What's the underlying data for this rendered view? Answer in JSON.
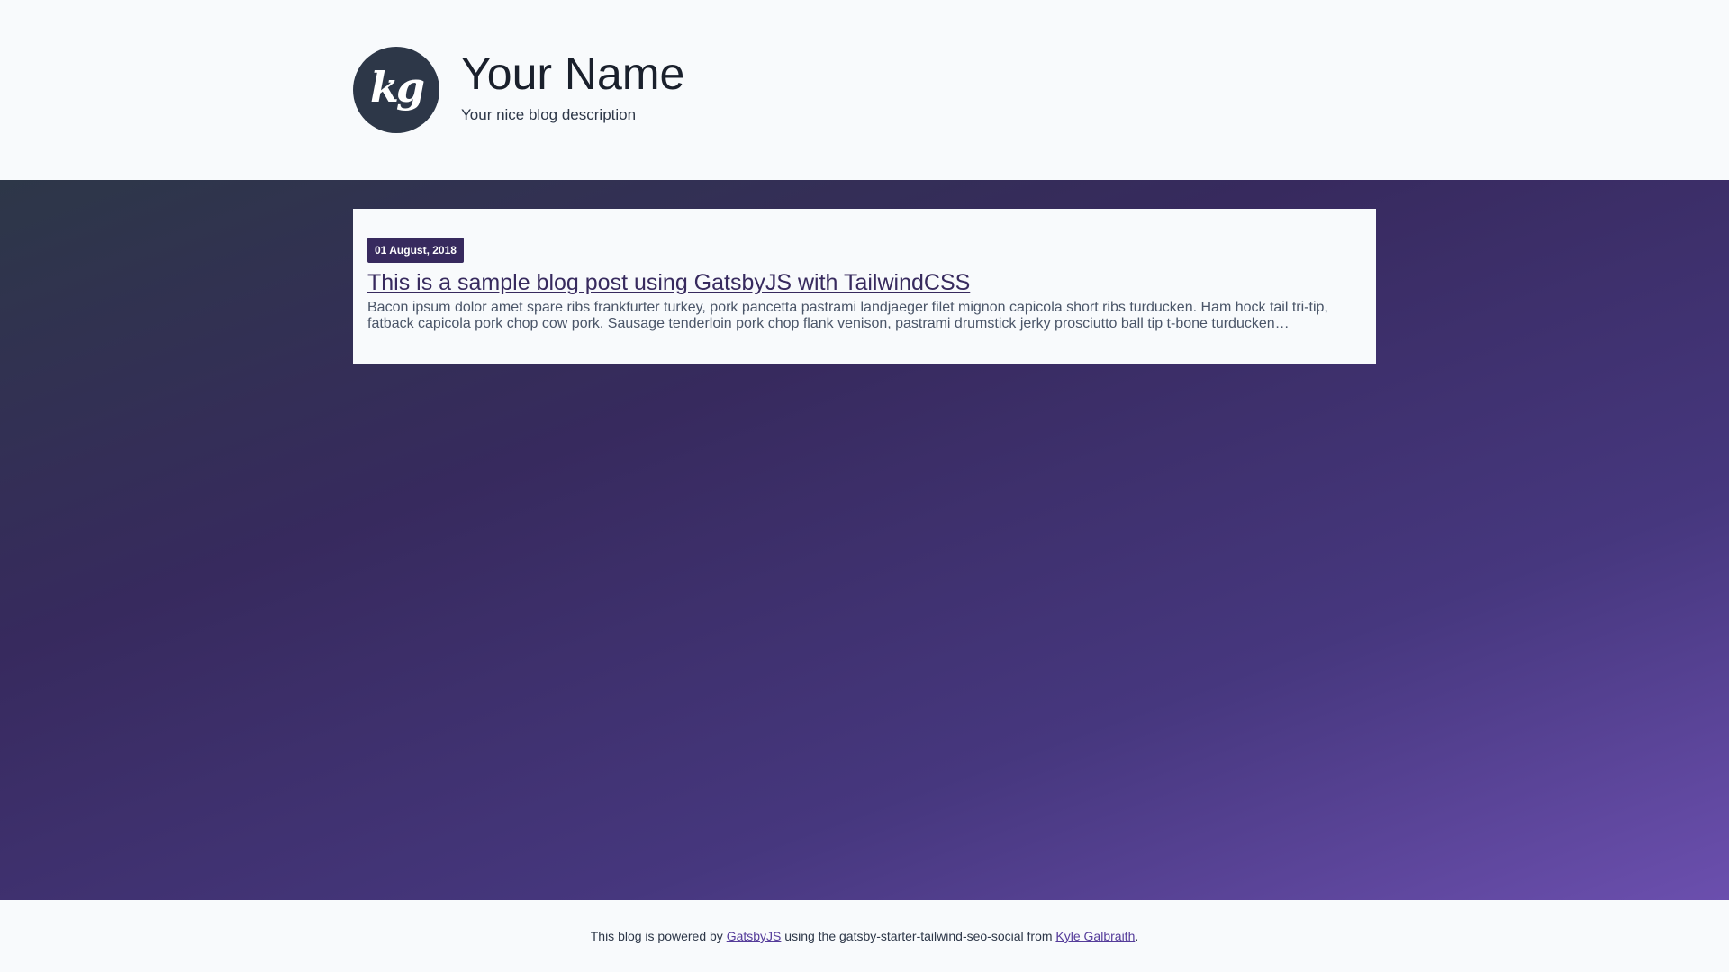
{
  "header": {
    "logo_text": "kg",
    "site_title": "Your Name",
    "site_description": "Your nice blog description"
  },
  "posts": [
    {
      "date": "01 August, 2018",
      "title": "This is a sample blog post using GatsbyJS with TailwindCSS",
      "excerpt": "Bacon ipsum dolor amet spare ribs frankfurter turkey, pork pancetta pastrami landjaeger filet mignon capicola short ribs turducken. Ham hock tail tri-tip, fatback capicola pork chop cow pork. Sausage tenderloin pork chop flank venison, pastrami drumstick jerky prosciutto ball tip t-bone turducken…"
    }
  ],
  "footer": {
    "text_before": "This blog is powered by ",
    "link1_label": "GatsbyJS",
    "text_middle": " using the gatsby-starter-tailwind-seo-social from ",
    "link2_label": "Kyle Galbraith",
    "text_after": "."
  },
  "colors": {
    "accent": "#372a5e",
    "link": "#553c9a",
    "logo_bg": "#2d3748",
    "page_bg": "#f8fafc"
  }
}
